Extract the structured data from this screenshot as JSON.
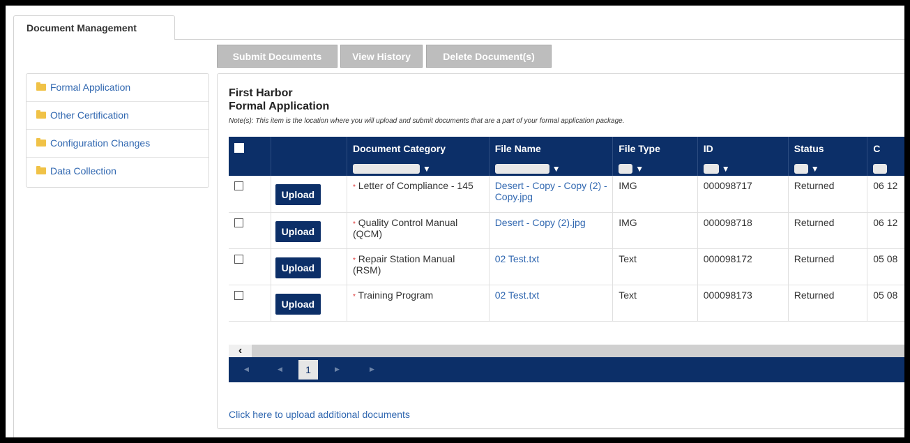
{
  "tab": {
    "label": "Document Management"
  },
  "toolbar": {
    "submit_label": "Submit Documents",
    "history_label": "View History",
    "delete_label": "Delete Document(s)"
  },
  "sidebar": {
    "items": [
      {
        "label": "Formal Application"
      },
      {
        "label": "Other Certification"
      },
      {
        "label": "Configuration Changes"
      },
      {
        "label": "Data Collection"
      }
    ]
  },
  "panel": {
    "title": "First Harbor",
    "subtitle": "Formal Application",
    "note": "Note(s): This item is the location where you will upload and submit documents that are a part of your formal application package.",
    "upload_link": "Click here to upload additional documents"
  },
  "grid": {
    "columns": [
      "",
      "",
      "Document Category",
      "File Name",
      "File Type",
      "ID",
      "Status",
      "C"
    ],
    "upload_label": "Upload",
    "required_mark": "*",
    "rows": [
      {
        "category": "Letter of Compliance - 145",
        "file_name": "Desert - Copy - Copy (2) - Copy.jpg",
        "file_type": "IMG",
        "id": "000098717",
        "status": "Returned",
        "date_clip": "06 12"
      },
      {
        "category": "Quality Control Manual (QCM)",
        "file_name": "Desert - Copy (2).jpg",
        "file_type": "IMG",
        "id": "000098718",
        "status": "Returned",
        "date_clip": "06 12"
      },
      {
        "category": "Repair Station Manual (RSM)",
        "file_name": "02 Test.txt",
        "file_type": "Text",
        "id": "000098172",
        "status": "Returned",
        "date_clip": "05 08"
      },
      {
        "category": "Training Program",
        "file_name": "02 Test.txt",
        "file_type": "Text",
        "id": "000098173",
        "status": "Returned",
        "date_clip": "05 08"
      }
    ],
    "pager": {
      "current_page": "1"
    }
  },
  "icons": {
    "folder": "folder-icon",
    "filter": "funnel-icon",
    "scroll_left": "chevron-left-icon"
  }
}
